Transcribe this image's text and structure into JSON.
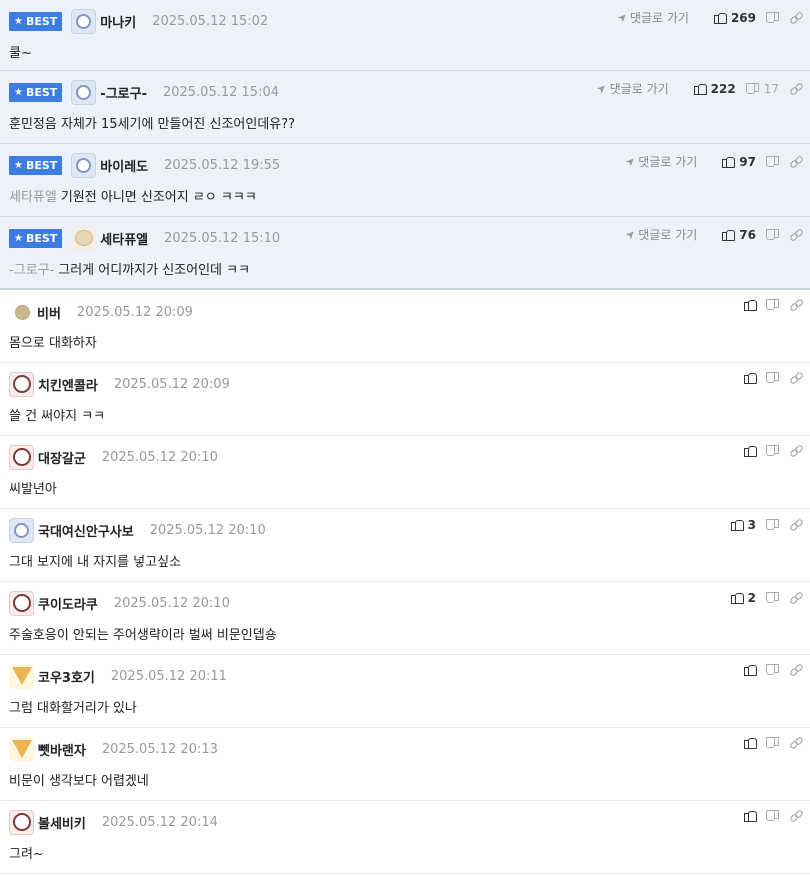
{
  "labels": {
    "reply": "댓글로 가기",
    "best": "BEST"
  },
  "best_comments": [
    {
      "nick": "마나키",
      "date": "2025.05.12 15:02",
      "mention": "",
      "text": "쿨~",
      "likes": "269",
      "dislikes": "",
      "avatar": "icon-avatar"
    },
    {
      "nick": "-그로구-",
      "date": "2025.05.12 15:04",
      "mention": "",
      "text": "훈민정음 자체가 15세기에 만들어진 신조어인데유??",
      "likes": "222",
      "dislikes": "17",
      "avatar": "icon-avatar"
    },
    {
      "nick": "바이레도",
      "date": "2025.05.12 19:55",
      "mention": "세타퓨엘",
      "text": "기원전 아니면 신조어지 ㄹㅇ ㅋㅋㅋ",
      "likes": "97",
      "dislikes": "",
      "avatar": "icon-avatar"
    },
    {
      "nick": "세타퓨엘",
      "date": "2025.05.12 15:10",
      "mention": "-그로구-",
      "text": "그러게 어디까지가 신조어인데 ㅋㅋ",
      "likes": "76",
      "dislikes": "",
      "avatar": "puppy-avatar"
    }
  ],
  "comments": [
    {
      "nick": "비버",
      "date": "2025.05.12 20:09",
      "text": "몸으로 대화하자",
      "likes": "",
      "avatar": "dot-avatar"
    },
    {
      "nick": "치킨엔콜라",
      "date": "2025.05.12 20:09",
      "text": "쓸 건 써야지 ㅋㅋ",
      "likes": "",
      "avatar": "dog-avatar"
    },
    {
      "nick": "대장갈군",
      "date": "2025.05.12 20:10",
      "text": "씨발년아",
      "likes": "",
      "avatar": "dog-avatar"
    },
    {
      "nick": "국대여신안구사보",
      "date": "2025.05.12 20:10",
      "text": "그대 보지에 내 자지를 넣고싶소",
      "likes": "3",
      "avatar": "icon-avatar"
    },
    {
      "nick": "쿠이도라쿠",
      "date": "2025.05.12 20:10",
      "text": "주술호응이 안되는 주어생략이라 벌써 비문인뎁숑",
      "likes": "2",
      "avatar": "dog-avatar"
    },
    {
      "nick": "코우3호기",
      "date": "2025.05.12 20:11",
      "text": "그럼 대화할거리가 있나",
      "likes": "",
      "avatar": "fox-avatar"
    },
    {
      "nick": "뻿바랜자",
      "date": "2025.05.12 20:13",
      "text": "비문이 생각보다 어렵겠네",
      "likes": "",
      "avatar": "fox-avatar"
    },
    {
      "nick": "볼세비키",
      "date": "2025.05.12 20:14",
      "text": "그려~",
      "likes": "",
      "avatar": "dog-avatar"
    }
  ]
}
